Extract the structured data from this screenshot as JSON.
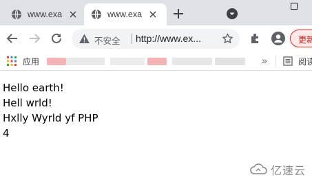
{
  "tabs": [
    {
      "title": "www.exa",
      "active": false
    },
    {
      "title": "www.exa",
      "active": true
    }
  ],
  "toolbar": {
    "security_label": "不安全",
    "url": "http://www.ex..."
  },
  "update_button": {
    "label": "更新"
  },
  "bookmarks": {
    "apps_label": "应用",
    "reading_list_label": "阅读"
  },
  "content": {
    "lines": [
      "Hello earth!",
      "Hell wrld!",
      "Hxlly Wyrld yf PHP",
      "4"
    ]
  },
  "watermark": {
    "text": "亿速云"
  },
  "colors": {
    "tabstrip": "#dee1e6",
    "omnibox": "#f1f3f4",
    "update_border": "#d93025",
    "update_text": "#c5221f",
    "blur_pink": "#f4b4b4",
    "blur_gray": "#e4e4e4"
  }
}
